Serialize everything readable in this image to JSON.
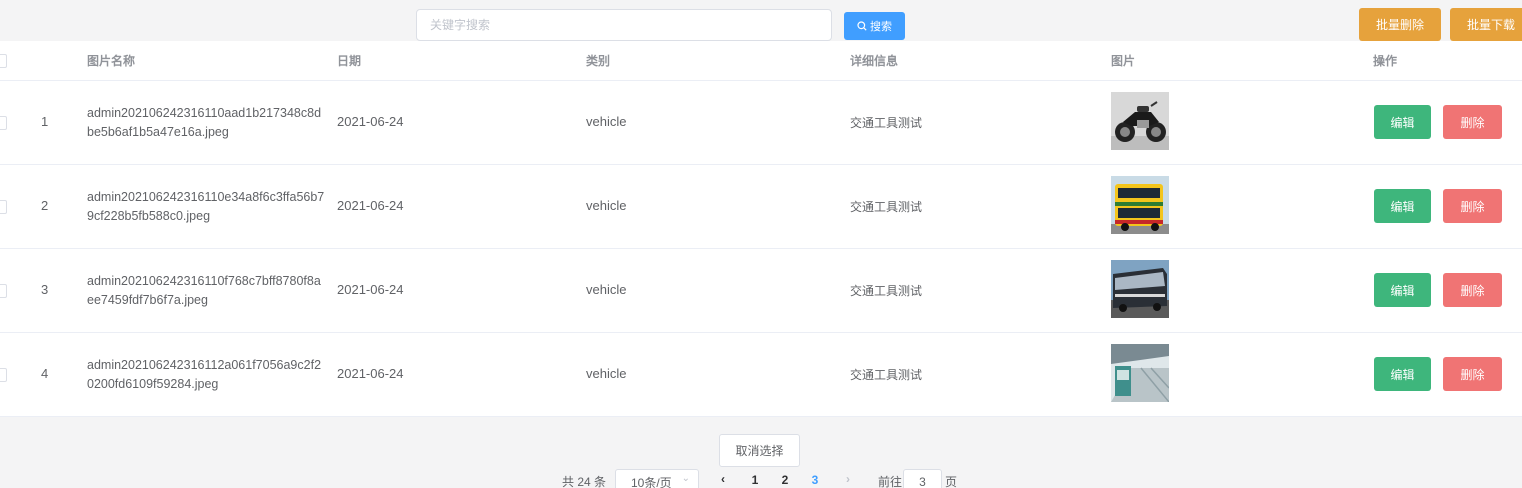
{
  "toolbar": {
    "search_placeholder": "关键字搜索",
    "search_label": "搜索",
    "batch_delete_label": "批量删除",
    "batch_download_label": "批量下载"
  },
  "table": {
    "headers": [
      "图片名称",
      "日期",
      "类别",
      "详细信息",
      "图片",
      "操作"
    ],
    "rows": [
      {
        "index": "1",
        "filename": "admin202106242316110aad1b217348c8dbe5b6af1b5a47e16a.jpeg",
        "date": "2021-06-24",
        "category": "vehicle",
        "info": "交通工具测试",
        "image": "motorcycle"
      },
      {
        "index": "2",
        "filename": "admin202106242316110e34a8f6c3ffa56b79cf228b5fb588c0.jpeg",
        "date": "2021-06-24",
        "category": "vehicle",
        "info": "交通工具测试",
        "image": "double-decker-bus"
      },
      {
        "index": "3",
        "filename": "admin202106242316110f768c7bff8780f8aee7459fdf7b6f7a.jpeg",
        "date": "2021-06-24",
        "category": "vehicle",
        "info": "交通工具测试",
        "image": "coach-bus"
      },
      {
        "index": "4",
        "filename": "admin202106242316112a061f7056a9c2f20200fd6109f59284.jpeg",
        "date": "2021-06-24",
        "category": "vehicle",
        "info": "交通工具测试",
        "image": "station-platform"
      }
    ],
    "edit_label": "编辑",
    "delete_label": "删除"
  },
  "cancel_selection_label": "取消选择",
  "pagination": {
    "total_text": "共 24 条",
    "page_size": "10条/页",
    "pages": [
      "1",
      "2",
      "3"
    ],
    "current_page": "3",
    "goto_label": "前往",
    "goto_value": "3",
    "page_suffix": "页"
  },
  "colors": {
    "primary": "#409eff",
    "warning": "#e6a23c",
    "success": "#3eb67c",
    "danger": "#f07474"
  }
}
